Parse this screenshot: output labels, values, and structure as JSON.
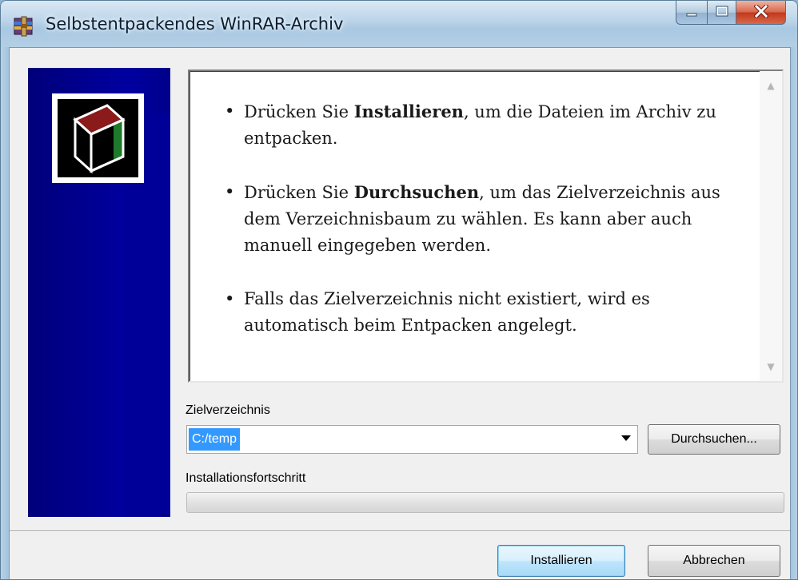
{
  "window": {
    "title": "Selbstentpackendes WinRAR-Archiv",
    "icons": {
      "app": "winrar-archive-icon",
      "minimize": "minimize-icon",
      "maximize": "maximize-icon",
      "close": "close-icon"
    }
  },
  "banner": {
    "logo_icon": "winrar-box-icon"
  },
  "info": {
    "bullets": [
      {
        "before": "Drücken Sie ",
        "bold": "Installieren",
        "after": ", um die Dateien im Archiv zu entpacken."
      },
      {
        "before": "Drücken Sie ",
        "bold": "Durchsuchen",
        "after": ", um das Zielverzeichnis aus dem Verzeichnisbaum zu wählen. Es kann aber auch manuell eingegeben werden."
      },
      {
        "before": "Falls das Zielverzeichnis nicht existiert, wird es automatisch beim Entpacken angelegt.",
        "bold": "",
        "after": ""
      }
    ],
    "bullet_glyph": "•"
  },
  "destination": {
    "label": "Zielverzeichnis",
    "value": "C:/temp",
    "browse_label": "Durchsuchen..."
  },
  "progress": {
    "label": "Installationsfortschritt",
    "percent": 0
  },
  "footer": {
    "install_label": "Installieren",
    "cancel_label": "Abbrechen"
  },
  "colors": {
    "banner": "#000088",
    "selection": "#3399ff"
  }
}
